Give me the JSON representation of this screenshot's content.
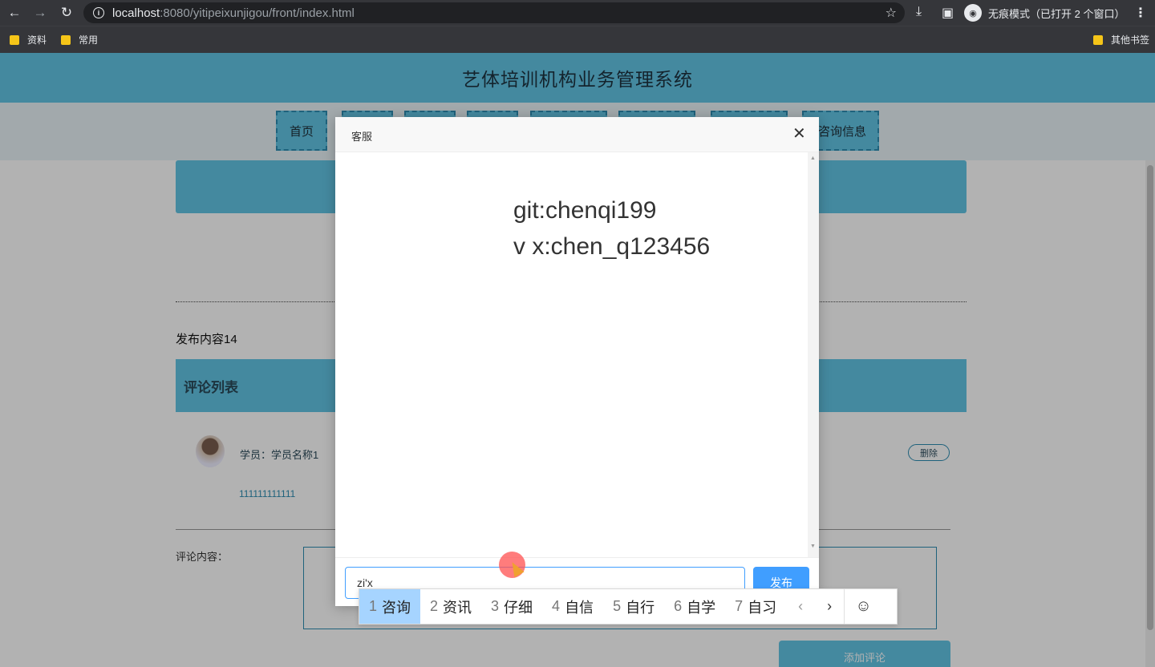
{
  "browser": {
    "url_host": "localhost",
    "url_path": ":8080/yitipeixunjigou/front/index.html",
    "incognito_label": "无痕模式（已打开 2 个窗口）",
    "bookmarks": [
      "资料",
      "常用"
    ],
    "other_bookmarks": "其他书签"
  },
  "site": {
    "title": "艺体培训机构业务管理系统",
    "nav": [
      "首页",
      "咨询信息"
    ]
  },
  "post": {
    "content": "发布内容14",
    "comment_list_title": "评论列表",
    "comments": [
      {
        "author": "学员：学员名称1",
        "text": "111111111111",
        "delete_label": "删除"
      }
    ],
    "comment_label": "评论内容：",
    "add_comment_label": "添加评论"
  },
  "modal": {
    "title": "客服",
    "messages": [
      "git:chenqi199",
      "v x:chen_q123456"
    ],
    "input_value": "zi'x",
    "send_label": "发布"
  },
  "ime": {
    "candidates": [
      {
        "num": "1",
        "text": "咨询"
      },
      {
        "num": "2",
        "text": "资讯"
      },
      {
        "num": "3",
        "text": "仔细"
      },
      {
        "num": "4",
        "text": "自信"
      },
      {
        "num": "5",
        "text": "自行"
      },
      {
        "num": "6",
        "text": "自学"
      },
      {
        "num": "7",
        "text": "自习"
      }
    ],
    "prev": "‹",
    "next": "›",
    "emoji": "☺"
  },
  "colors": {
    "accent": "#62c4e4",
    "primary_button": "#409eff",
    "browser_chrome": "#35363a"
  }
}
